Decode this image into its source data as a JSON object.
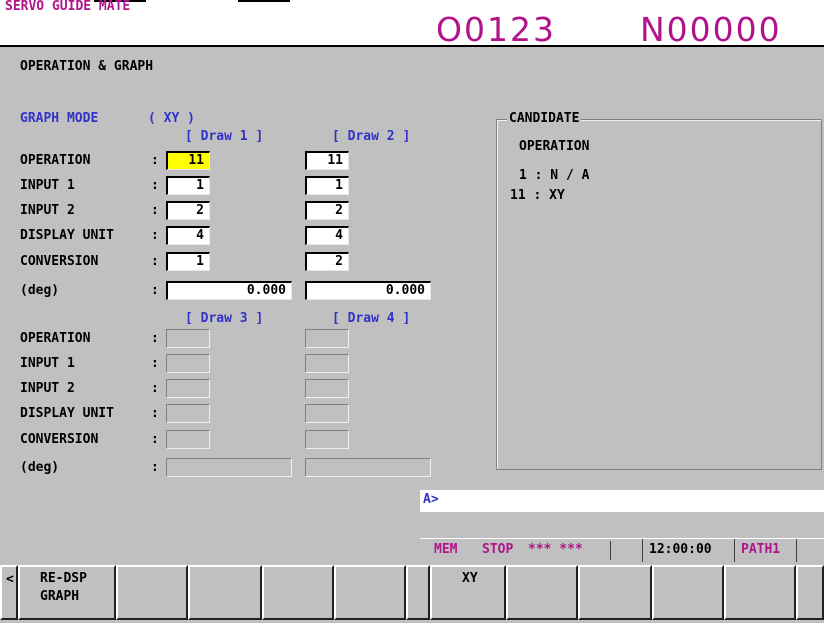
{
  "header": {
    "app_title": "SERVO GUIDE MATE",
    "program_number": "O0123",
    "sequence_number": "N00000"
  },
  "screen_title": "OPERATION & GRAPH",
  "graph_mode": {
    "label": "GRAPH MODE",
    "value": "( XY )"
  },
  "draw_headers": [
    "[ Draw 1 ]",
    "[ Draw 2 ]",
    "[ Draw 3 ]",
    "[ Draw 4 ]"
  ],
  "row_labels": [
    "OPERATION",
    "INPUT 1",
    "INPUT 2",
    "DISPLAY UNIT",
    "CONVERSION",
    "(deg)"
  ],
  "colon": ":",
  "draw1": {
    "operation": "11",
    "input1": "1",
    "input2": "2",
    "display_unit": "4",
    "conversion": "1",
    "deg": "0.000"
  },
  "draw2": {
    "operation": "11",
    "input1": "1",
    "input2": "2",
    "display_unit": "4",
    "conversion": "2",
    "deg": "0.000"
  },
  "draw3": {
    "operation": "",
    "input1": "",
    "input2": "",
    "display_unit": "",
    "conversion": "",
    "deg": ""
  },
  "draw4": {
    "operation": "",
    "input1": "",
    "input2": "",
    "display_unit": "",
    "conversion": "",
    "deg": ""
  },
  "candidate": {
    "title": "CANDIDATE",
    "heading": "OPERATION",
    "items": [
      "1 : N / A",
      "11 : XY"
    ]
  },
  "input_line": {
    "prompt": "A>",
    "value": ""
  },
  "status": {
    "mode": "MEM",
    "state": "STOP",
    "alarm": "*** ***",
    "time": "12:00:00",
    "path": "PATH1"
  },
  "softkeys": {
    "left_arrow": "<",
    "redsp_line1": "RE-DSP",
    "redsp_line2": "GRAPH",
    "xy": "XY"
  },
  "colors": {
    "accent": "#b0138a",
    "label_blue": "#3232c8",
    "highlight": "#ffff00",
    "background": "#c0c0c0"
  }
}
